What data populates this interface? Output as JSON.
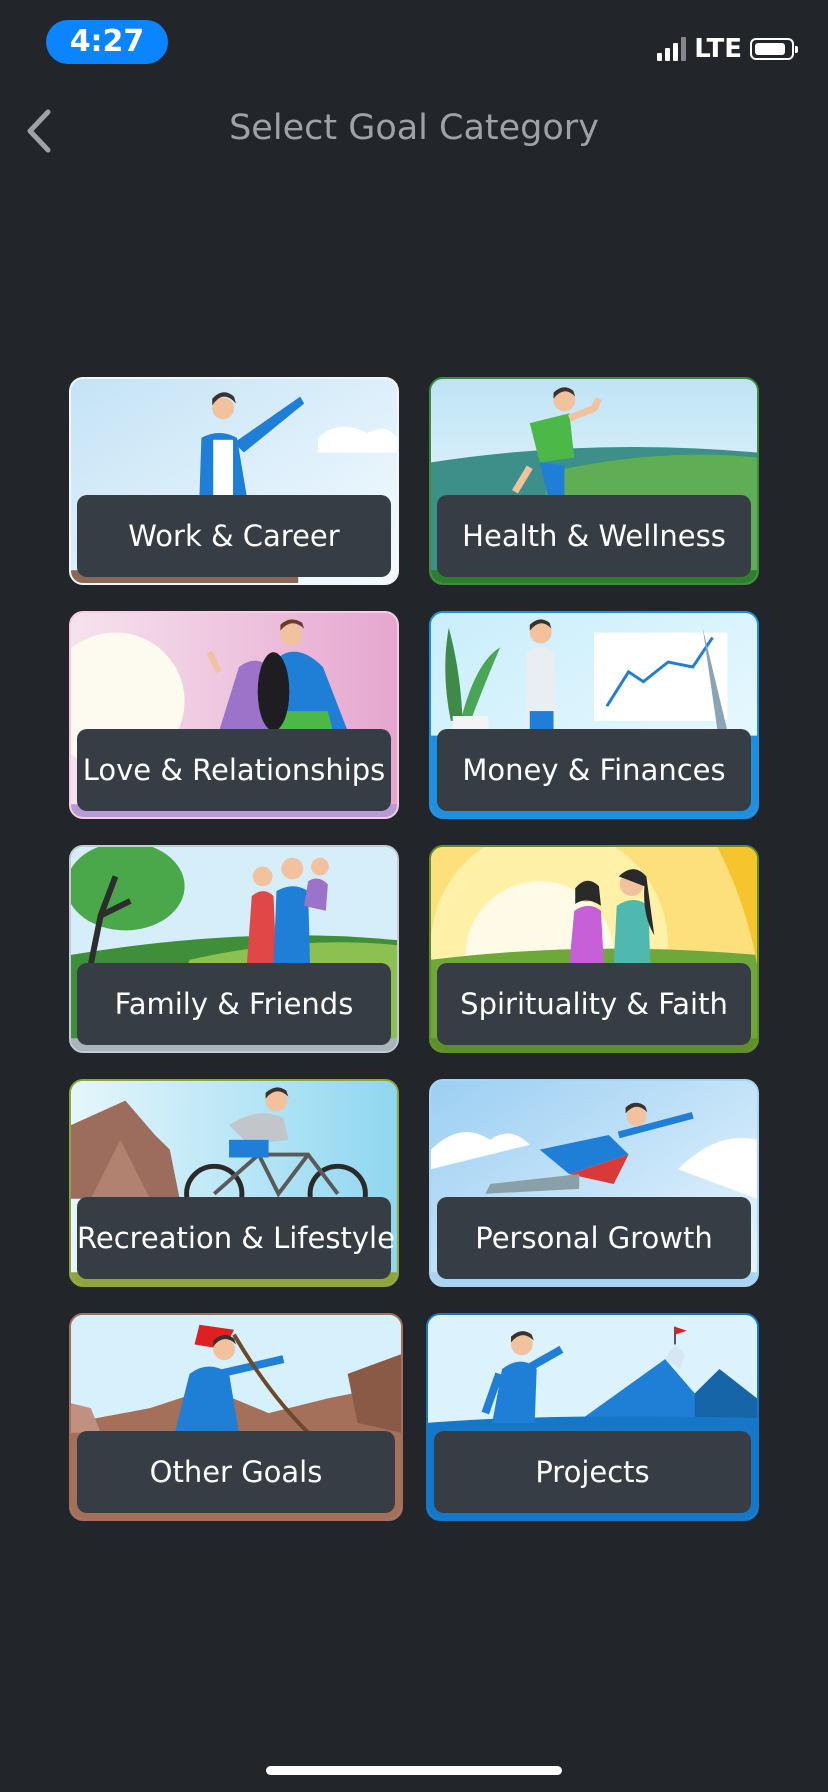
{
  "status_bar": {
    "time": "4:27",
    "network": "LTE"
  },
  "header": {
    "title": "Select Goal Category",
    "back_icon": "chevron-left-icon"
  },
  "categories": [
    {
      "label": "Work & Career",
      "accent": "#8a6a57"
    },
    {
      "label": "Health & Wellness",
      "accent": "#2f7d2f"
    },
    {
      "label": "Love & Relationships",
      "accent": "#b89ad6"
    },
    {
      "label": "Money & Finances",
      "accent": "#1f8fe0"
    },
    {
      "label": "Family & Friends",
      "accent": "#aab4bd"
    },
    {
      "label": "Spirituality & Faith",
      "accent": "#5f8f2a"
    },
    {
      "label": "Recreation & Lifestyle",
      "accent": "#8fa43a"
    },
    {
      "label": "Personal Growth",
      "accent": "#a9d4f2"
    },
    {
      "label": "Other Goals",
      "accent": "#a4705a"
    },
    {
      "label": "Projects",
      "accent": "#1577c8"
    }
  ]
}
